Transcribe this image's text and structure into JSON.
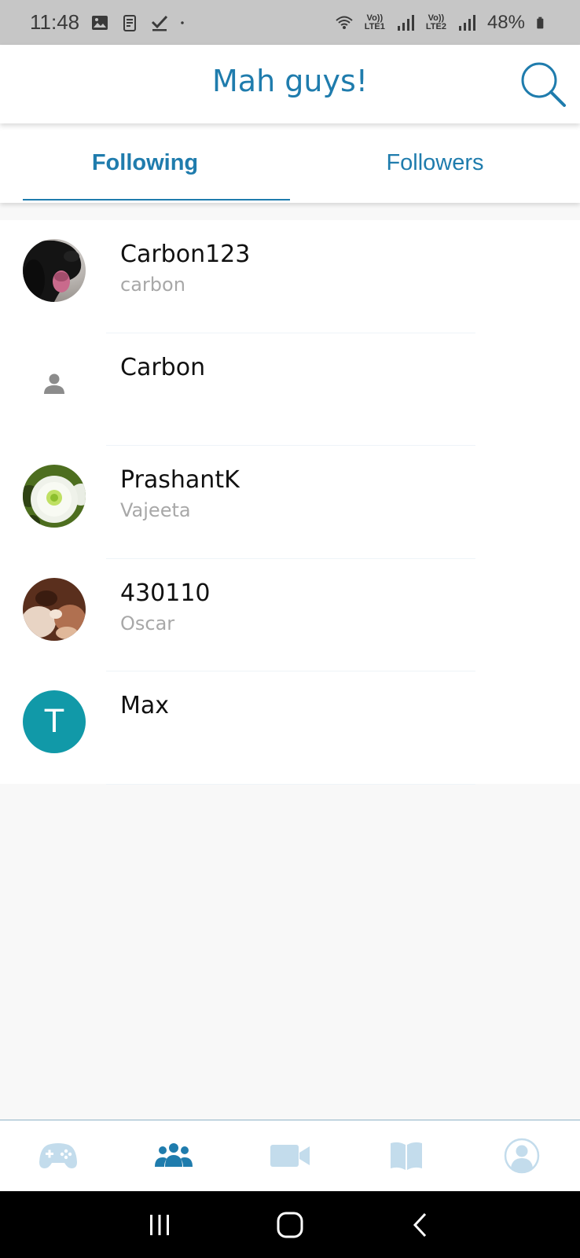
{
  "status_bar": {
    "time": "11:48",
    "battery": "48%",
    "sim1": "LTE1",
    "sim2": "LTE2",
    "volte": "Vo))"
  },
  "app_bar": {
    "title": "Mah guys!",
    "search_icon": "search-icon"
  },
  "tabs": [
    {
      "label": "Following",
      "active": true
    },
    {
      "label": "Followers",
      "active": false
    }
  ],
  "users": [
    {
      "name": "Carbon123",
      "username": "carbon",
      "avatar": "dog-photo"
    },
    {
      "name": "Carbon",
      "username": "",
      "avatar": "person-placeholder"
    },
    {
      "name": "PrashantK",
      "username": "Vajeeta",
      "avatar": "flower-photo"
    },
    {
      "name": "430110",
      "username": "Oscar",
      "avatar": "pet-photo"
    },
    {
      "name": "Max",
      "username": "",
      "avatar": "letter",
      "avatar_letter": "T"
    }
  ],
  "bottom_nav": [
    {
      "icon": "gamepad-icon",
      "active": false
    },
    {
      "icon": "people-icon",
      "active": true
    },
    {
      "icon": "video-camera-icon",
      "active": false
    },
    {
      "icon": "book-icon",
      "active": false
    },
    {
      "icon": "profile-icon",
      "active": false
    }
  ],
  "colors": {
    "accent": "#1f7cad",
    "inactive_icon": "#c3dcec",
    "letter_avatar": "#1199a8"
  }
}
